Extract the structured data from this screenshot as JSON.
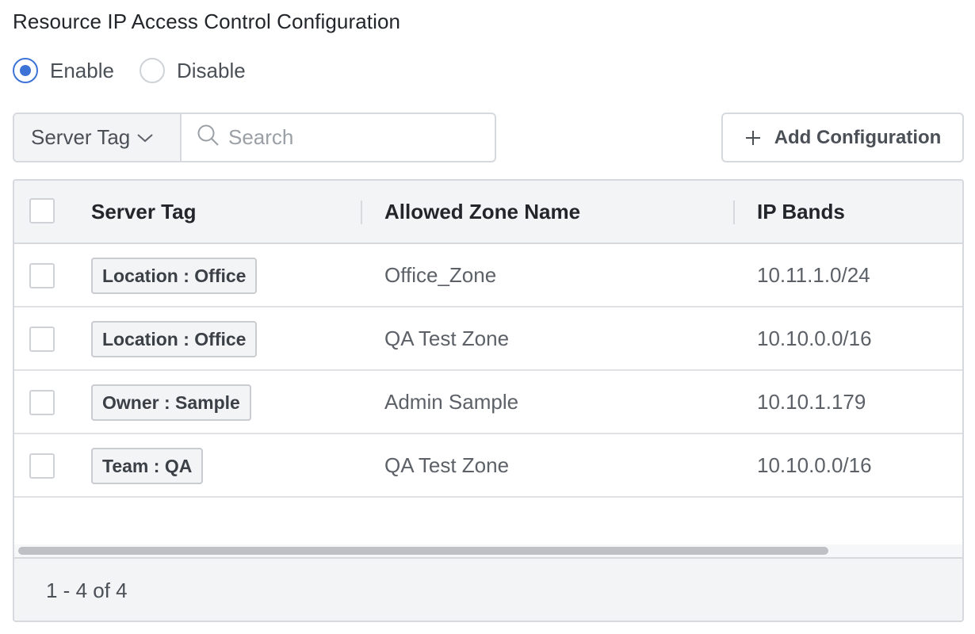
{
  "page": {
    "title": "Resource IP Access Control Configuration"
  },
  "access_control": {
    "options": [
      {
        "label": "Enable",
        "selected": true
      },
      {
        "label": "Disable",
        "selected": false
      }
    ]
  },
  "filter": {
    "field_label": "Server Tag",
    "search_placeholder": "Search",
    "search_value": ""
  },
  "toolbar": {
    "add_label": "Add Configuration"
  },
  "table": {
    "columns": [
      "Server Tag",
      "Allowed Zone Name",
      "IP Bands"
    ],
    "rows": [
      {
        "tag": "Location : Office",
        "zone": "Office_Zone",
        "ip": "10.11.1.0/24"
      },
      {
        "tag": "Location : Office",
        "zone": "QA Test Zone",
        "ip": "10.10.0.0/16"
      },
      {
        "tag": "Owner : Sample",
        "zone": "Admin Sample",
        "ip": "10.10.1.179"
      },
      {
        "tag": "Team : QA",
        "zone": "QA Test Zone",
        "ip": "10.10.0.0/16"
      }
    ]
  },
  "pagination": {
    "text": "1 - 4 of 4"
  },
  "icons": {
    "filter_chevron": "chevron-down-icon",
    "search": "search-icon",
    "add": "plus-icon"
  },
  "colors": {
    "accent": "#3d73d6",
    "border": "#d6d9dd",
    "header_bg": "#f3f4f6"
  }
}
